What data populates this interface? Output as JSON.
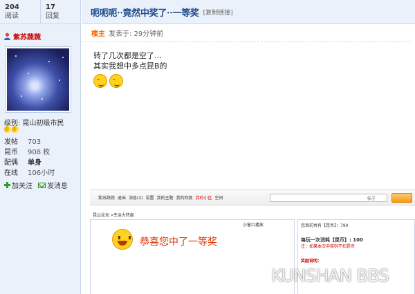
{
  "sidebar": {
    "stats": [
      {
        "value": "204",
        "label": "阅读"
      },
      {
        "value": "17",
        "label": "回复"
      }
    ],
    "author_name": "紫苏蔬蔬",
    "level": "级别: 昆山初级市民",
    "info": [
      {
        "label": "发帖",
        "value": "703"
      },
      {
        "label": "昆币",
        "value": "908 枚"
      },
      {
        "label": "配偶",
        "value": "单身"
      },
      {
        "label": "在线",
        "value": "106小时"
      }
    ],
    "follow_label": "加关注",
    "message_label": "发消息"
  },
  "post": {
    "title": "呃呃呃··竟然中奖了··一等奖",
    "copy_link": "[复制链接]",
    "louzhu": "楼主",
    "posted_at": "发表于: 29分钟前",
    "lines": [
      "转了几次都是空了…",
      "其实我想中多点昆B的"
    ]
  },
  "embedded": {
    "user": "紫苏蔬蔬",
    "nav": [
      "退出",
      "消息(2)",
      "设置",
      "我的主题",
      "我的回复",
      "我的小区",
      "空间"
    ],
    "search_label": "帖子",
    "crumb": "昆山论坛 »幸运大转盘",
    "small_window": "小窗口播放",
    "congrats": "恭喜您中了一等奖",
    "right_lines": {
      "total": "您目前共有【昆币】：790",
      "cost": "每玩一次消耗【昆币】: 100",
      "note": "注：如果本次中奖则不扣昆币",
      "rules_head": "奖励说明："
    }
  },
  "watermark": "KUNSHAN BBS"
}
